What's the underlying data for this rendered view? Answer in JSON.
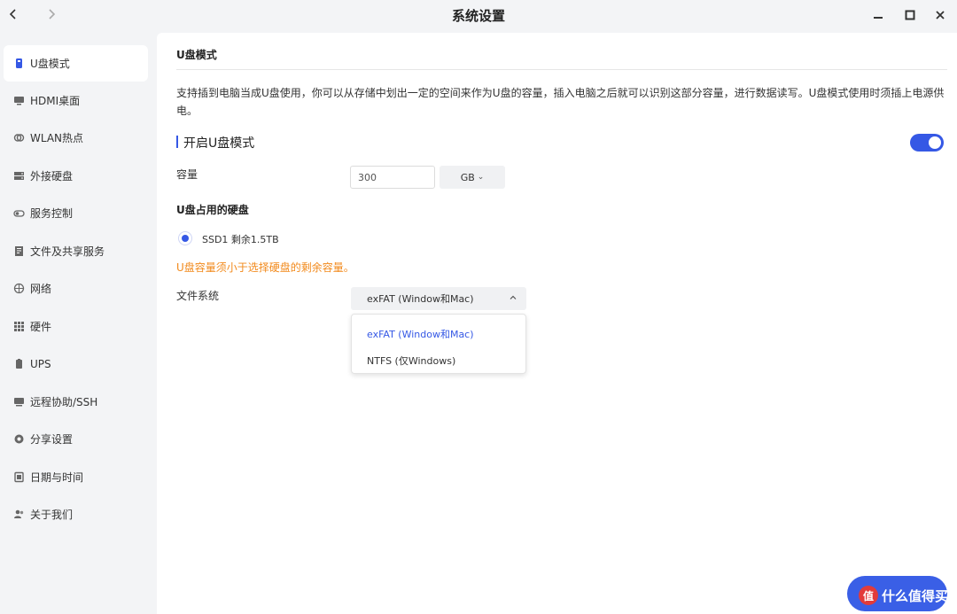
{
  "window": {
    "title": "系统设置",
    "back_icon": "chevron-left-icon",
    "forward_icon": "chevron-right-icon",
    "minimize_icon": "minimize-icon",
    "maximize_icon": "maximize-icon",
    "close_icon": "close-icon"
  },
  "sidebar": {
    "items": [
      {
        "label": "U盘模式",
        "icon": "usb-drive-icon",
        "active": true
      },
      {
        "label": "HDMI桌面",
        "icon": "monitor-icon"
      },
      {
        "label": "WLAN热点",
        "icon": "wifi-hotspot-icon"
      },
      {
        "label": "外接硬盘",
        "icon": "external-disk-icon"
      },
      {
        "label": "服务控制",
        "icon": "toggle-switch-icon"
      },
      {
        "label": "文件及共享服务",
        "icon": "file-share-icon"
      },
      {
        "label": "网络",
        "icon": "globe-icon"
      },
      {
        "label": "硬件",
        "icon": "grid-icon"
      },
      {
        "label": "UPS",
        "icon": "battery-icon"
      },
      {
        "label": "远程协助/SSH",
        "icon": "remote-screen-icon"
      },
      {
        "label": "分享设置",
        "icon": "share-icon"
      },
      {
        "label": "日期与时间",
        "icon": "calendar-icon"
      },
      {
        "label": "关于我们",
        "icon": "users-icon"
      }
    ]
  },
  "main": {
    "section_title": "U盘模式",
    "description": "支持插到电脑当成U盘使用，你可以从存储中划出一定的空间来作为U盘的容量，插入电脑之后就可以识别这部分容量，进行数据读写。U盘模式使用时须插上电源供电。",
    "enable_label": "开启U盘模式",
    "enable_on": true,
    "capacity_label": "容量",
    "capacity_value": "300",
    "capacity_unit": "GB",
    "disk_title": "U盘占用的硬盘",
    "disk_option": "SSD1 剩余1.5TB",
    "disk_selected": true,
    "warning": "U盘容量须小于选择硬盘的剩余容量。",
    "fs_label": "文件系统",
    "fs_selected": "exFAT (Window和Mac)",
    "fs_options": [
      "exFAT (Window和Mac)",
      "NTFS (仅Windows)"
    ]
  },
  "watermark": {
    "text": "什么值得买",
    "logo_char": "值"
  },
  "colors": {
    "accent": "#3558e5",
    "warning": "#f28a1c",
    "sidebar_bg": "#f3f4f6",
    "panel_bg": "#ffffff"
  }
}
